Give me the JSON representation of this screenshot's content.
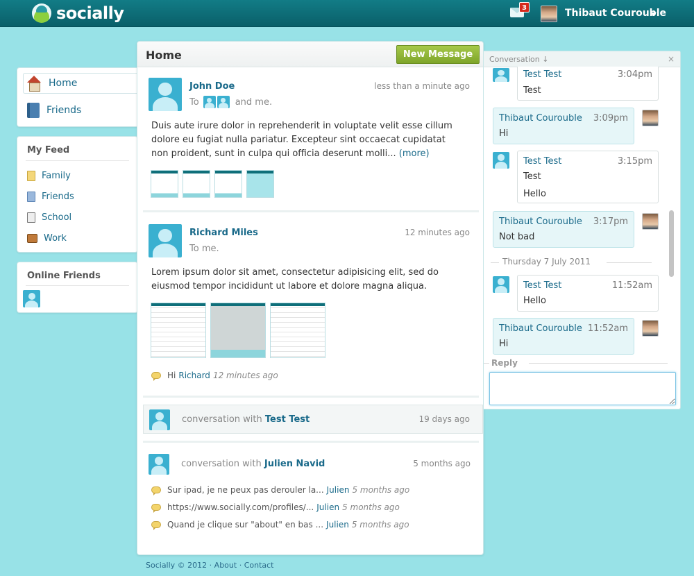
{
  "header": {
    "logo_text": "socially",
    "mail_count": "3",
    "user_name": "Thibaut Courouble"
  },
  "sidebar": {
    "nav": [
      {
        "label": "Home",
        "icon": "home-icon",
        "active": true
      },
      {
        "label": "Friends",
        "icon": "address-book-icon"
      }
    ],
    "feed_title": "My Feed",
    "feed": [
      {
        "label": "Family",
        "icon": "folder-icon"
      },
      {
        "label": "Friends",
        "icon": "contacts-icon"
      },
      {
        "label": "School",
        "icon": "notebook-icon"
      },
      {
        "label": "Work",
        "icon": "briefcase-icon"
      }
    ],
    "online_title": "Online Friends"
  },
  "main": {
    "title": "Home",
    "new_message_label": "New Message",
    "posts": [
      {
        "name": "John Doe",
        "time": "less than a minute ago",
        "to_prefix": "To",
        "to_suffix": "and me.",
        "body": "Duis aute irure dolor in reprehenderit in voluptate velit esse cillum dolore eu fugiat nulla pariatur. Excepteur sint occaecat cupidatat non proident, sunt in culpa qui officia deserunt molli...",
        "more": "(more)"
      },
      {
        "name": "Richard Miles",
        "time": "12 minutes ago",
        "to_text": "To me.",
        "body": "Lorem ipsum dolor sit amet, consectetur adipisicing elit, sed do eiusmod tempor incididunt ut labore et dolore magna aliqua.",
        "comment": {
          "text": "Hi",
          "name": "Richard",
          "time": "12 minutes ago"
        }
      }
    ],
    "conversations": [
      {
        "prefix": "conversation with",
        "name": "Test Test",
        "time": "19 days ago"
      },
      {
        "prefix": "conversation with",
        "name": "Julien Navid",
        "time": "5 months ago",
        "comments": [
          {
            "text": "Sur ipad, je ne peux pas derouler la...",
            "name": "Julien",
            "time": "5 months ago"
          },
          {
            "text": "https://www.socially.com/profiles/...",
            "name": "Julien",
            "time": "5 months ago"
          },
          {
            "text": "Quand je clique sur \"about\" en bas ...",
            "name": "Julien",
            "time": "5 months ago"
          }
        ]
      }
    ]
  },
  "footer": {
    "copyright": "Socially © 2012",
    "sep": "·",
    "about": "About",
    "contact": "Contact"
  },
  "conversation_panel": {
    "title": "Conversation ↓",
    "close": "×",
    "messages": [
      {
        "name": "Test Test",
        "time": "3:04pm",
        "lines": [
          "Test"
        ]
      },
      {
        "name": "Thibaut Courouble",
        "time": "3:09pm",
        "lines": [
          "Hi"
        ]
      },
      {
        "name": "Test Test",
        "time": "3:15pm",
        "lines": [
          "Test",
          "Hello"
        ]
      },
      {
        "name": "Thibaut Courouble",
        "time": "3:17pm",
        "lines": [
          "Not bad"
        ]
      },
      {
        "name": "Test Test",
        "time": "11:52am",
        "lines": [
          "Hello"
        ]
      },
      {
        "name": "Thibaut Courouble",
        "time": "11:52am",
        "lines": [
          "Hi"
        ]
      }
    ],
    "date_separator": "Thursday 7 July 2011",
    "reply_label": "Reply"
  }
}
